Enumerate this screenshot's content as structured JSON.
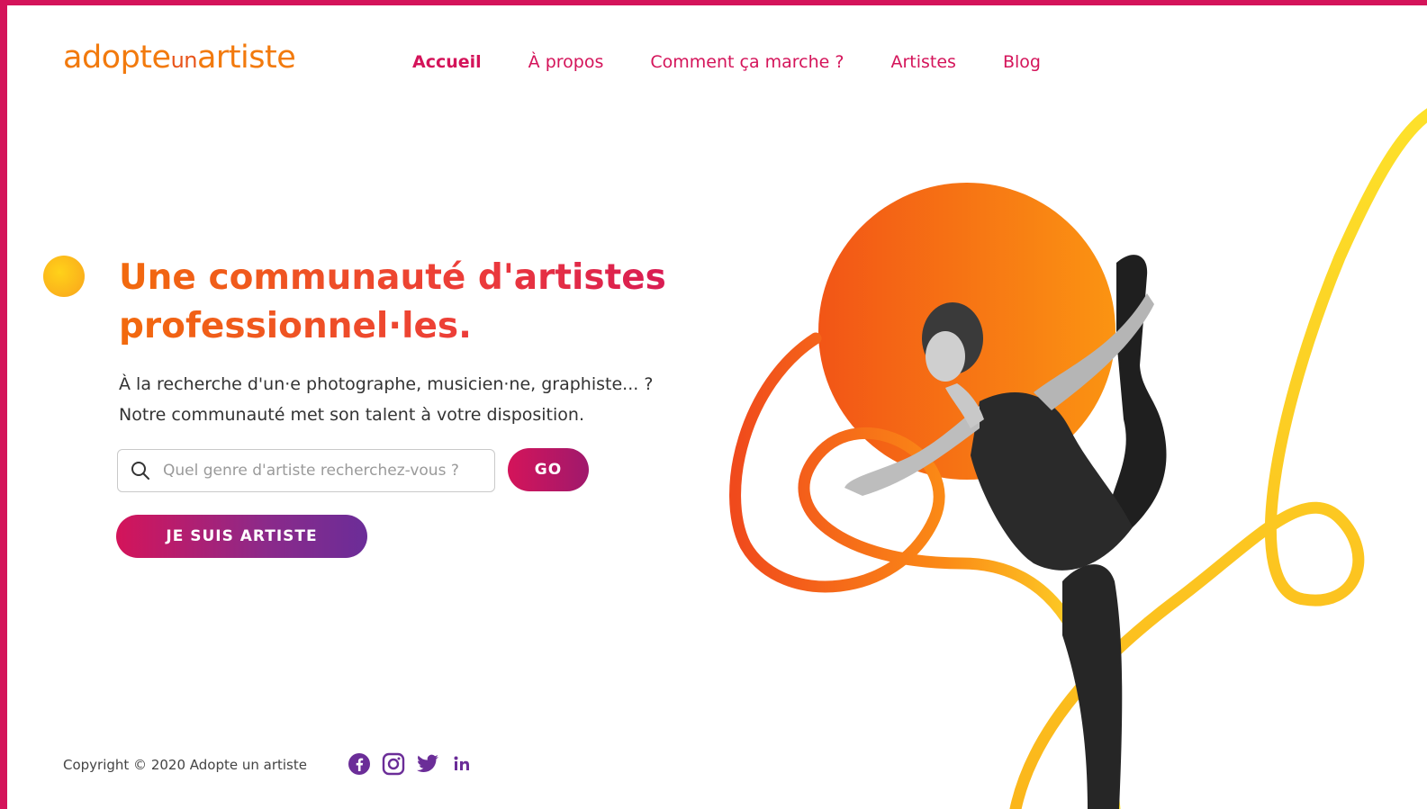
{
  "logo": {
    "part1": "adopte",
    "part2": "un",
    "part3": "artiste"
  },
  "nav": {
    "items": [
      {
        "label": "Accueil"
      },
      {
        "label": "À propos"
      },
      {
        "label": "Comment ça marche ?"
      },
      {
        "label": "Artistes"
      },
      {
        "label": "Blog"
      }
    ]
  },
  "hero": {
    "title_line1": "Une communauté d'artistes",
    "title_line2": "professionnel·les.",
    "subtitle_line1": "À la recherche d'un·e photographe, musicien·ne, graphiste... ?",
    "subtitle_line2": "Notre communauté met son talent à votre disposition."
  },
  "search": {
    "placeholder": "Quel genre d'artiste recherchez-vous ?",
    "value": "",
    "go_label": "GO"
  },
  "cta": {
    "artist_label": "JE SUIS ARTISTE"
  },
  "footer": {
    "copyright": "Copyright © 2020 Adopte un artiste",
    "socials": [
      "facebook-icon",
      "instagram-icon",
      "twitter-icon",
      "linkedin-icon"
    ]
  },
  "colors": {
    "brand_pink": "#d4145a",
    "brand_orange": "#f27a0d",
    "brand_purple": "#6b2d98",
    "accent_yellow": "#fdd835"
  }
}
